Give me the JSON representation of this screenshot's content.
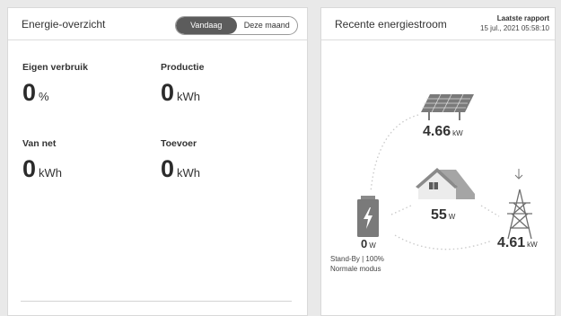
{
  "overview": {
    "title": "Energie-overzicht",
    "toggle": {
      "today": "Vandaag",
      "month": "Deze maand",
      "selected": "Vandaag"
    },
    "stats": {
      "eigen_verbruik": {
        "label": "Eigen verbruik",
        "value": "0",
        "unit": "%"
      },
      "productie": {
        "label": "Productie",
        "value": "0",
        "unit": "kWh"
      },
      "van_net": {
        "label": "Van net",
        "value": "0",
        "unit": "kWh"
      },
      "toevoer": {
        "label": "Toevoer",
        "value": "0",
        "unit": "kWh"
      }
    }
  },
  "flow": {
    "title": "Recente energiestroom",
    "report": {
      "label": "Laatste rapport",
      "time": "15 jul., 2021 05:58:10"
    },
    "solar": {
      "value": "4.66",
      "unit": "kW",
      "icon": "solar-panel-icon"
    },
    "home": {
      "value": "55",
      "unit": "W",
      "icon": "house-icon"
    },
    "battery": {
      "value": "0",
      "unit": "W",
      "icon": "battery-icon",
      "status": "Stand-By | 100%",
      "mode": "Normale modus"
    },
    "grid": {
      "value": "4.61",
      "unit": "kW",
      "icon": "power-tower-icon",
      "arrow": "arrow-down-icon"
    }
  },
  "colors": {
    "toggle_active": "#5c5c5c",
    "battery": "#7a7a7a",
    "icon": "#8a8a8a"
  }
}
